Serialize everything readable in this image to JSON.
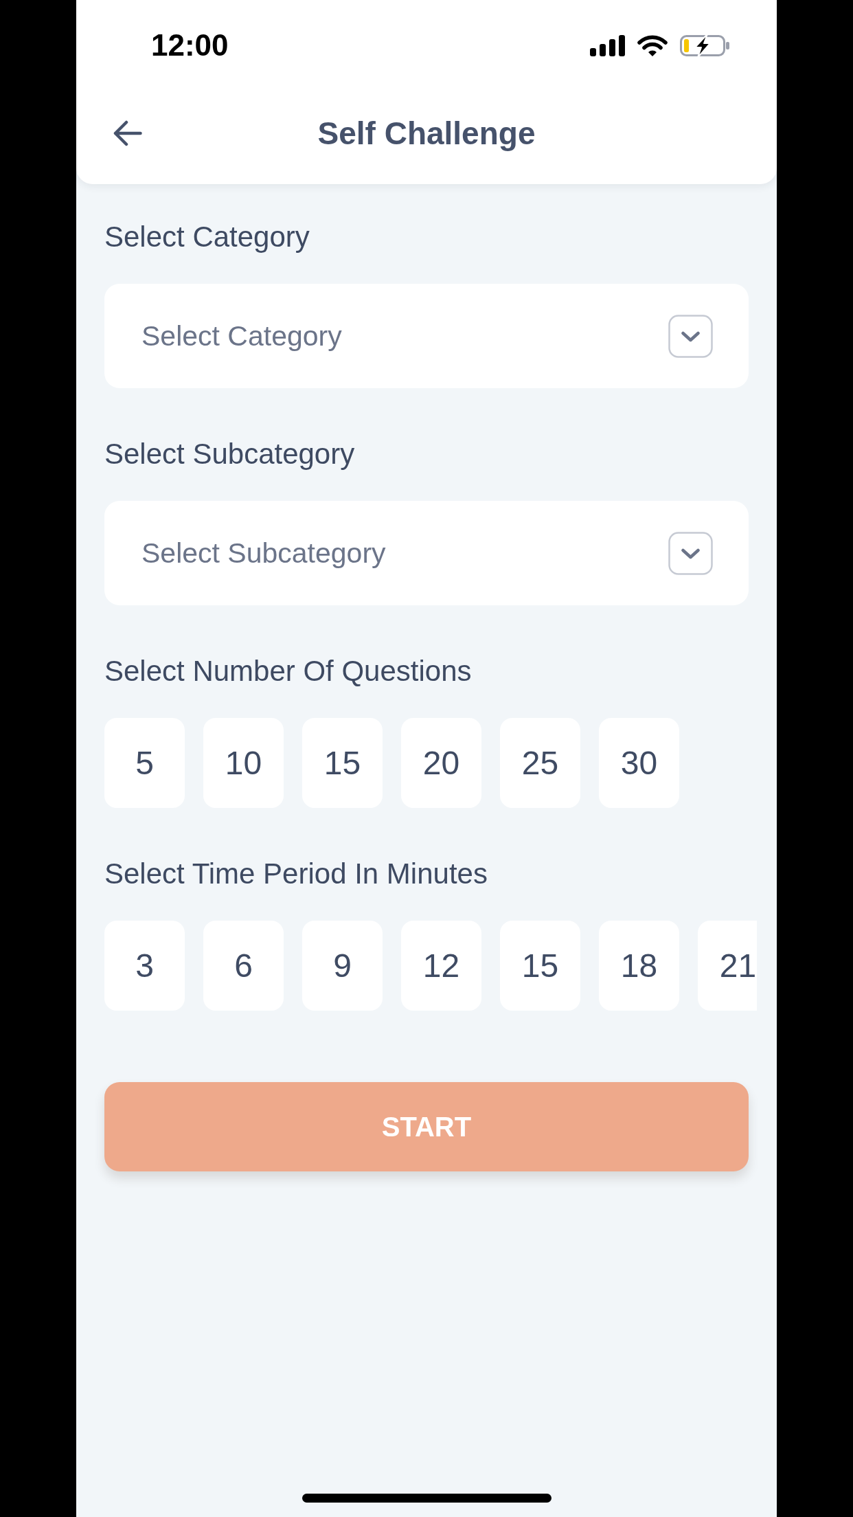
{
  "status_bar": {
    "time": "12:00"
  },
  "header": {
    "title": "Self Challenge"
  },
  "sections": [
    {
      "kind": "dropdown",
      "label": "Select Category",
      "placeholder": "Select Category"
    },
    {
      "kind": "dropdown",
      "label": "Select Subcategory",
      "placeholder": "Select Subcategory"
    },
    {
      "kind": "options",
      "label": "Select Number Of Questions",
      "options": [
        {
          "label": "5",
          "selected": false
        },
        {
          "label": "10",
          "selected": false
        },
        {
          "label": "15",
          "selected": false
        },
        {
          "label": "20",
          "selected": false
        },
        {
          "label": "25",
          "selected": false
        },
        {
          "label": "30",
          "selected": false
        }
      ]
    },
    {
      "kind": "options",
      "label": "Select Time Period In Minutes",
      "options": [
        {
          "label": "3",
          "selected": false
        },
        {
          "label": "6",
          "selected": false
        },
        {
          "label": "9",
          "selected": false
        },
        {
          "label": "12",
          "selected": false
        },
        {
          "label": "15",
          "selected": false
        },
        {
          "label": "18",
          "selected": false
        },
        {
          "label": "21",
          "selected": false
        }
      ]
    }
  ],
  "start_button": {
    "label": "START",
    "disabled": true
  }
}
